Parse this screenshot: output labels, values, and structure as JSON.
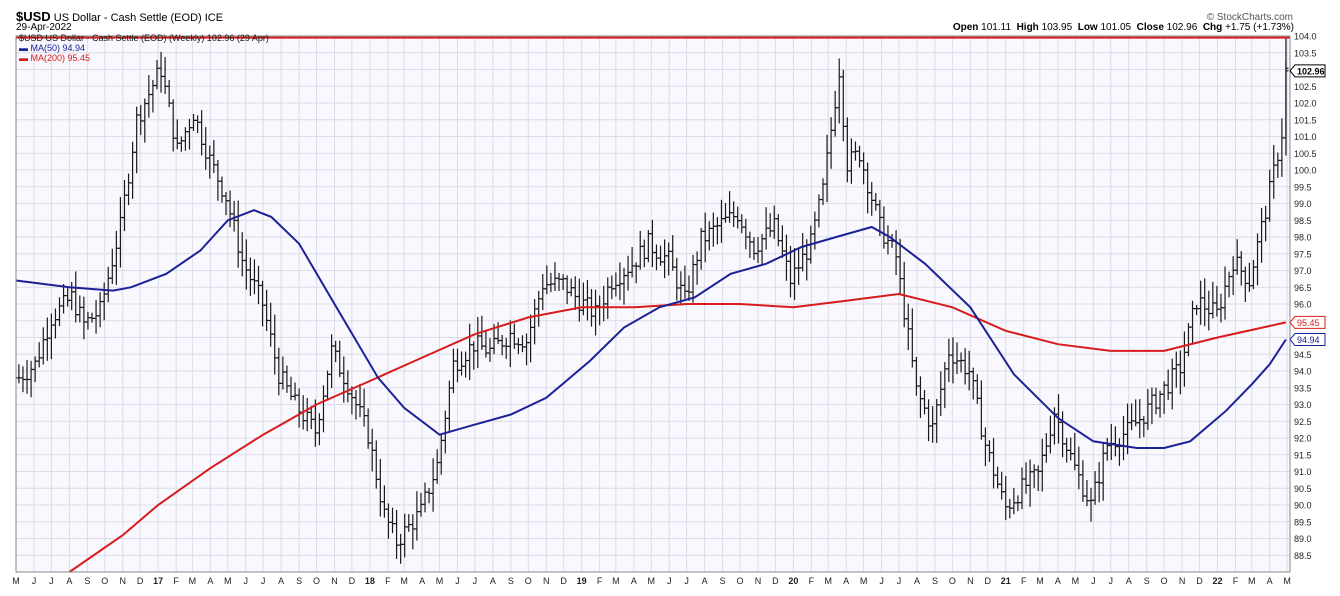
{
  "header": {
    "symbol": "$USD",
    "name": "US Dollar - Cash Settle (EOD) ICE",
    "date": "29-Apr-2022",
    "copyright": "© StockCharts.com",
    "open_label": "Open",
    "open": "101.11",
    "high_label": "High",
    "high": "103.95",
    "low_label": "Low",
    "low": "101.05",
    "close_label": "Close",
    "close": "102.96",
    "chg_label": "Chg",
    "chg": "+1.75 (+1.73%)"
  },
  "legend": {
    "price": "$USD US Dollar - Cash Settle (EOD) (Weekly) 102.96 (29 Apr)",
    "ma50": "MA(50) 94.94",
    "ma200": "MA(200) 95.45"
  },
  "colors": {
    "price": "#1a1a1a",
    "ma50": "#1c2196",
    "ma200": "#d81c1c",
    "hline": "#d81c1c",
    "grid": "#dcdce8",
    "bg": "#f8f8fe"
  },
  "chart_data": {
    "type": "line",
    "ylim": [
      88.0,
      104.0
    ],
    "y_ticks": [
      "88.5",
      "89.0",
      "89.5",
      "90.0",
      "90.5",
      "91.0",
      "91.5",
      "92.0",
      "92.5",
      "93.0",
      "93.5",
      "94.0",
      "94.5",
      "95.0",
      "95.5",
      "96.0",
      "96.5",
      "97.0",
      "97.5",
      "98.0",
      "98.5",
      "99.0",
      "99.5",
      "100.0",
      "100.5",
      "101.0",
      "101.5",
      "102.0",
      "102.5",
      "103.0",
      "103.5",
      "104.0"
    ],
    "x_ticks": [
      "M",
      "J",
      "J",
      "A",
      "S",
      "O",
      "N",
      "D",
      "17",
      "F",
      "M",
      "A",
      "M",
      "J",
      "J",
      "A",
      "S",
      "O",
      "N",
      "D",
      "18",
      "F",
      "M",
      "A",
      "M",
      "J",
      "J",
      "A",
      "S",
      "O",
      "N",
      "D",
      "19",
      "F",
      "M",
      "A",
      "M",
      "J",
      "J",
      "A",
      "S",
      "O",
      "N",
      "D",
      "20",
      "F",
      "M",
      "A",
      "M",
      "J",
      "J",
      "A",
      "S",
      "O",
      "N",
      "D",
      "21",
      "F",
      "M",
      "A",
      "M",
      "J",
      "J",
      "A",
      "S",
      "O",
      "N",
      "D",
      "22",
      "F",
      "M",
      "A",
      "M"
    ],
    "x_range": [
      "2016-05-01",
      "2022-05-06"
    ],
    "horizontal_line": 103.95,
    "price_labels": {
      "close": "102.96",
      "ma200": "95.45",
      "ma50": "94.94"
    },
    "series": [
      {
        "name": "$USD (Weekly)",
        "style": "ohlc",
        "points": [
          [
            "2016-05-06",
            93.8
          ],
          [
            "2016-06-03",
            94.2
          ],
          [
            "2016-07-01",
            95.6
          ],
          [
            "2016-08-05",
            96.2
          ],
          [
            "2016-08-26",
            95.4
          ],
          [
            "2016-09-23",
            95.8
          ],
          [
            "2016-10-28",
            98.3
          ],
          [
            "2016-11-25",
            101.5
          ],
          [
            "2016-12-30",
            102.8
          ],
          [
            "2017-01-06",
            103.0
          ],
          [
            "2017-02-03",
            100.6
          ],
          [
            "2017-03-03",
            101.7
          ],
          [
            "2017-03-31",
            100.3
          ],
          [
            "2017-04-28",
            99.2
          ],
          [
            "2017-05-26",
            97.3
          ],
          [
            "2017-06-30",
            96.0
          ],
          [
            "2017-07-28",
            93.9
          ],
          [
            "2017-08-25",
            93.0
          ],
          [
            "2017-09-29",
            92.2
          ],
          [
            "2017-10-27",
            94.6
          ],
          [
            "2017-11-24",
            93.6
          ],
          [
            "2017-12-29",
            92.1
          ],
          [
            "2018-01-26",
            89.7
          ],
          [
            "2018-02-16",
            88.9
          ],
          [
            "2018-03-30",
            89.8
          ],
          [
            "2018-04-27",
            91.2
          ],
          [
            "2018-05-25",
            94.2
          ],
          [
            "2018-06-29",
            94.8
          ],
          [
            "2018-07-27",
            94.6
          ],
          [
            "2018-08-31",
            95.1
          ],
          [
            "2018-09-28",
            94.9
          ],
          [
            "2018-10-26",
            96.6
          ],
          [
            "2018-11-30",
            96.6
          ],
          [
            "2018-12-28",
            96.1
          ],
          [
            "2019-01-25",
            95.7
          ],
          [
            "2019-02-22",
            96.7
          ],
          [
            "2019-03-29",
            97.2
          ],
          [
            "2019-04-26",
            97.8
          ],
          [
            "2019-05-31",
            97.3
          ],
          [
            "2019-06-28",
            96.1
          ],
          [
            "2019-07-26",
            97.9
          ],
          [
            "2019-08-30",
            98.4
          ],
          [
            "2019-09-27",
            98.7
          ],
          [
            "2019-10-25",
            97.7
          ],
          [
            "2019-11-29",
            98.3
          ],
          [
            "2019-12-27",
            96.7
          ],
          [
            "2020-01-31",
            97.8
          ],
          [
            "2020-02-21",
            99.4
          ],
          [
            "2020-03-20",
            103.0
          ],
          [
            "2020-04-03",
            100.2
          ],
          [
            "2020-04-24",
            100.5
          ],
          [
            "2020-05-29",
            98.3
          ],
          [
            "2020-06-26",
            97.4
          ],
          [
            "2020-07-31",
            93.4
          ],
          [
            "2020-08-28",
            92.3
          ],
          [
            "2020-09-25",
            94.6
          ],
          [
            "2020-10-30",
            94.0
          ],
          [
            "2020-11-27",
            91.8
          ],
          [
            "2020-12-31",
            89.9
          ],
          [
            "2021-01-29",
            90.5
          ],
          [
            "2021-02-26",
            90.9
          ],
          [
            "2021-03-26",
            92.8
          ],
          [
            "2021-04-30",
            91.1
          ],
          [
            "2021-05-28",
            90.0
          ],
          [
            "2021-06-25",
            91.8
          ],
          [
            "2021-07-30",
            92.2
          ],
          [
            "2021-08-27",
            92.7
          ],
          [
            "2021-09-24",
            93.3
          ],
          [
            "2021-10-29",
            94.1
          ],
          [
            "2021-11-26",
            96.1
          ],
          [
            "2021-12-31",
            95.7
          ],
          [
            "2022-01-28",
            97.3
          ],
          [
            "2022-02-25",
            96.7
          ],
          [
            "2022-03-25",
            98.8
          ],
          [
            "2022-04-15",
            100.5
          ],
          [
            "2022-04-22",
            101.1
          ],
          [
            "2022-04-29",
            102.96
          ]
        ]
      },
      {
        "name": "MA(50)",
        "points": [
          [
            "2016-05-01",
            96.7
          ],
          [
            "2016-08-01",
            96.5
          ],
          [
            "2016-10-15",
            96.4
          ],
          [
            "2016-11-15",
            96.5
          ],
          [
            "2017-01-15",
            96.9
          ],
          [
            "2017-03-15",
            97.6
          ],
          [
            "2017-05-01",
            98.5
          ],
          [
            "2017-06-15",
            98.8
          ],
          [
            "2017-07-15",
            98.6
          ],
          [
            "2017-09-01",
            97.8
          ],
          [
            "2017-11-01",
            96.0
          ],
          [
            "2018-01-15",
            93.8
          ],
          [
            "2018-03-01",
            92.9
          ],
          [
            "2018-05-01",
            92.1
          ],
          [
            "2018-07-01",
            92.4
          ],
          [
            "2018-09-01",
            92.7
          ],
          [
            "2018-11-01",
            93.2
          ],
          [
            "2019-01-15",
            94.3
          ],
          [
            "2019-03-15",
            95.3
          ],
          [
            "2019-05-15",
            95.9
          ],
          [
            "2019-07-15",
            96.2
          ],
          [
            "2019-09-15",
            96.9
          ],
          [
            "2019-11-15",
            97.2
          ],
          [
            "2020-01-15",
            97.7
          ],
          [
            "2020-03-15",
            98.0
          ],
          [
            "2020-05-15",
            98.3
          ],
          [
            "2020-06-15",
            98.0
          ],
          [
            "2020-08-15",
            97.2
          ],
          [
            "2020-11-01",
            95.9
          ],
          [
            "2021-01-15",
            93.9
          ],
          [
            "2021-04-01",
            92.6
          ],
          [
            "2021-06-01",
            91.9
          ],
          [
            "2021-08-15",
            91.7
          ],
          [
            "2021-10-01",
            91.7
          ],
          [
            "2021-11-15",
            91.9
          ],
          [
            "2022-01-15",
            92.8
          ],
          [
            "2022-03-01",
            93.6
          ],
          [
            "2022-04-01",
            94.2
          ],
          [
            "2022-04-29",
            94.94
          ]
        ]
      },
      {
        "name": "MA(200)",
        "points": [
          [
            "2016-08-01",
            88.0
          ],
          [
            "2016-11-01",
            89.1
          ],
          [
            "2017-01-01",
            90.0
          ],
          [
            "2017-04-01",
            91.1
          ],
          [
            "2017-07-01",
            92.1
          ],
          [
            "2017-10-01",
            93.0
          ],
          [
            "2018-01-01",
            93.7
          ],
          [
            "2018-04-01",
            94.4
          ],
          [
            "2018-07-01",
            95.1
          ],
          [
            "2018-10-01",
            95.6
          ],
          [
            "2019-01-01",
            95.9
          ],
          [
            "2019-04-01",
            95.9
          ],
          [
            "2019-07-01",
            96.0
          ],
          [
            "2019-10-01",
            96.0
          ],
          [
            "2020-01-01",
            95.9
          ],
          [
            "2020-04-01",
            96.1
          ],
          [
            "2020-07-01",
            96.3
          ],
          [
            "2020-10-01",
            95.9
          ],
          [
            "2021-01-01",
            95.2
          ],
          [
            "2021-04-01",
            94.8
          ],
          [
            "2021-07-01",
            94.6
          ],
          [
            "2021-10-01",
            94.6
          ],
          [
            "2022-01-01",
            95.0
          ],
          [
            "2022-04-29",
            95.45
          ]
        ]
      }
    ]
  }
}
